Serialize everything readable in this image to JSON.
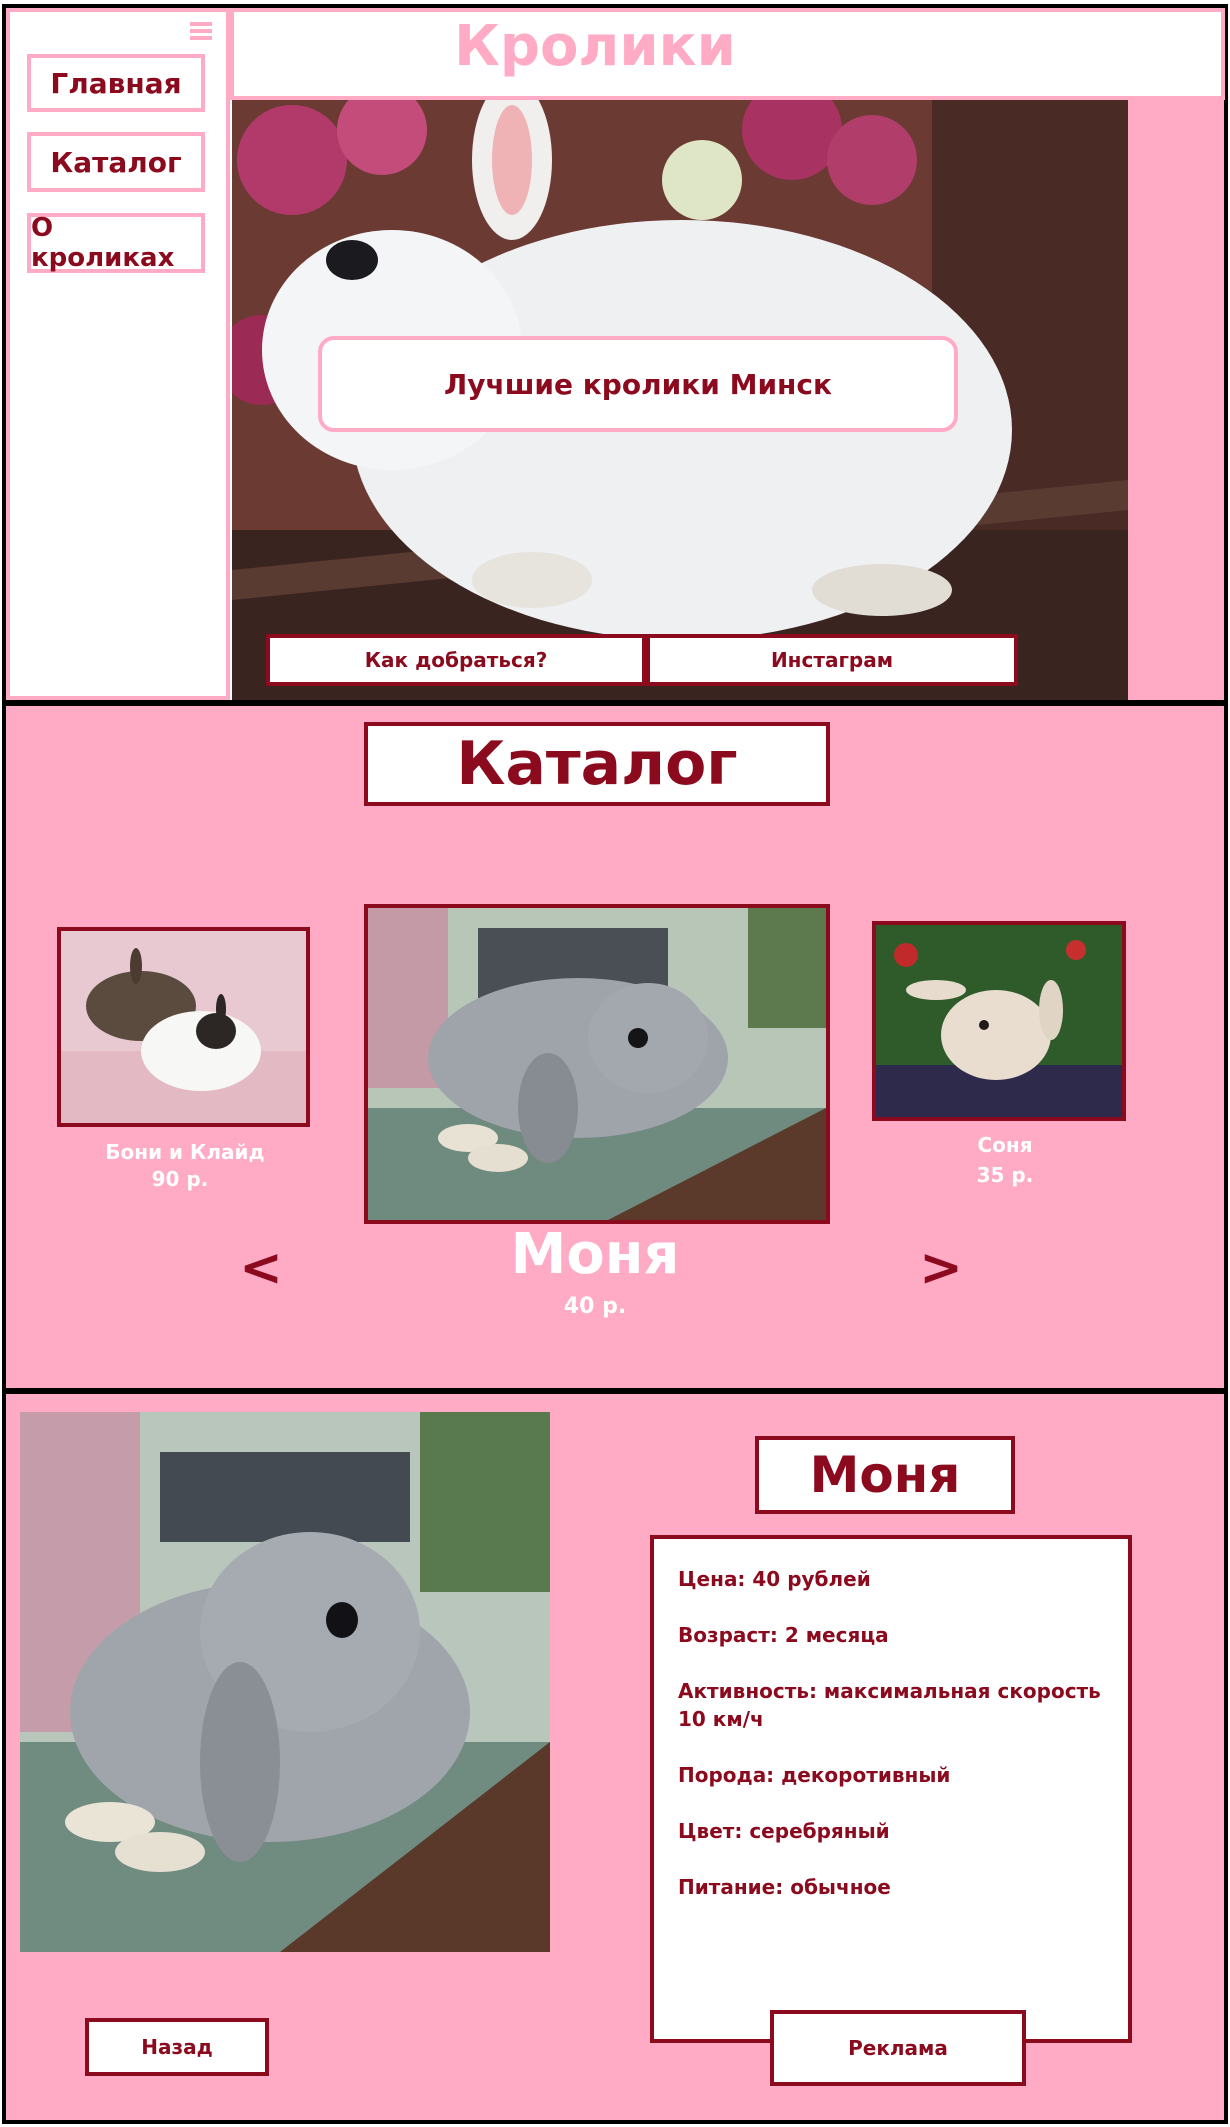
{
  "header": {
    "title": "Кролики",
    "menu_icon": "hamburger-menu-icon"
  },
  "sidebar": {
    "items": [
      {
        "label": "Главная"
      },
      {
        "label": "Каталог"
      },
      {
        "label": "О кроликах"
      }
    ]
  },
  "hero": {
    "banner_text": "Лучшие кролики Минск",
    "buttons": [
      "Как добраться?",
      "Инстаграм"
    ]
  },
  "catalog": {
    "title": "Каталог",
    "prev_arrow": "<",
    "next_arrow": ">",
    "items": [
      {
        "name": "Бони и Клайд",
        "price": "90 р."
      },
      {
        "name": "Моня",
        "price": "40 р."
      },
      {
        "name": "Соня",
        "price": "35 р."
      }
    ]
  },
  "detail": {
    "name": "Моня",
    "specs": [
      "Цена: 40 рублей",
      "Возраст: 2 месяца",
      "Активность: максимальная скорость 10 км/ч",
      "Порода: декоротивный",
      "Цвет: серебряный",
      "Питание: обычное"
    ],
    "back_button": "Назад",
    "ad_button": "Реклама"
  },
  "colors": {
    "accent": "#8b0a1e",
    "pink": "#ffabc6",
    "white": "#ffffff",
    "border": "#000000"
  }
}
